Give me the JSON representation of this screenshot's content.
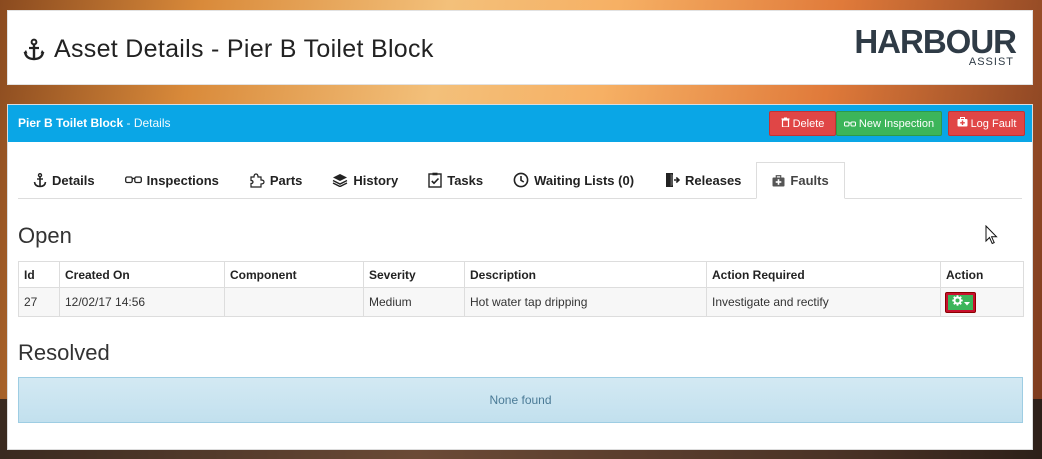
{
  "header": {
    "title": "Asset Details - Pier B Toilet Block",
    "logo_main": "HARBOUR",
    "logo_sub": "ASSIST"
  },
  "panel": {
    "title": "Pier B Toilet Block",
    "subtitle": "- Details",
    "buttons": {
      "delete": "Delete",
      "new_inspection": "New Inspection",
      "log_fault": "Log Fault"
    }
  },
  "tabs": [
    {
      "label": "Details",
      "icon": "anchor-icon"
    },
    {
      "label": "Inspections",
      "icon": "glasses-icon"
    },
    {
      "label": "Parts",
      "icon": "puzzle-icon"
    },
    {
      "label": "History",
      "icon": "layers-icon"
    },
    {
      "label": "Tasks",
      "icon": "checklist-icon"
    },
    {
      "label": "Waiting Lists (0)",
      "icon": "clock-icon"
    },
    {
      "label": "Releases",
      "icon": "sign-out-icon"
    },
    {
      "label": "Faults",
      "icon": "medkit-icon",
      "active": true
    }
  ],
  "open": {
    "heading": "Open",
    "columns": [
      "Id",
      "Created On",
      "Component",
      "Severity",
      "Description",
      "Action Required",
      "Action"
    ],
    "rows": [
      {
        "id": "27",
        "created_on": "12/02/17 14:56",
        "component": "",
        "severity": "Medium",
        "description": "Hot water tap dripping",
        "action_required": "Investigate and rectify"
      }
    ]
  },
  "resolved": {
    "heading": "Resolved",
    "empty_text": "None found"
  },
  "colors": {
    "bar": "#0aa6e6",
    "danger": "#e04646",
    "success": "#3cb55a",
    "info_box": "#c8e4f1"
  }
}
